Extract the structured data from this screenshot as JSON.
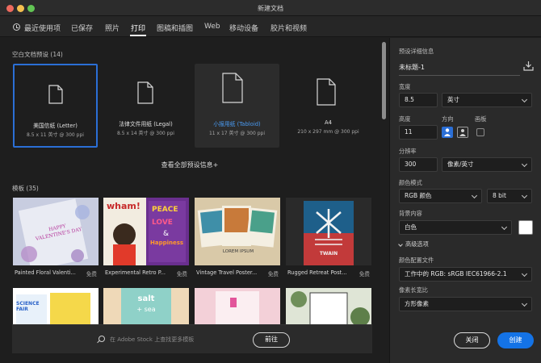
{
  "window": {
    "title": "新建文档"
  },
  "tabs": [
    {
      "label": "最近使用项"
    },
    {
      "label": "已保存"
    },
    {
      "label": "照片"
    },
    {
      "label": "打印"
    },
    {
      "label": "图稿和插图"
    },
    {
      "label": "Web"
    },
    {
      "label": "移动设备"
    },
    {
      "label": "胶片和视频"
    }
  ],
  "active_tab": "打印",
  "presets": {
    "label": "空白文档预设",
    "count": "(14)",
    "items": [
      {
        "name": "美国信纸 (Letter)",
        "detail": "8.5 x 11 英寸 @ 300 ppi",
        "state": "selected"
      },
      {
        "name": "法律文件用纸 (Legal)",
        "detail": "8.5 x 14 英寸 @ 300 ppi",
        "state": "normal"
      },
      {
        "name": "小报用纸 (Tabloid)",
        "detail": "11 x 17 英寸 @ 300 ppi",
        "state": "hover"
      },
      {
        "name": "A4",
        "detail": "210 x 297 mm @ 300 ppi",
        "state": "normal"
      }
    ],
    "view_all": "查看全部预设信息+"
  },
  "templates": {
    "label": "模板",
    "count": "(35)",
    "items": [
      {
        "name": "Painted Floral Valenti...",
        "badge": "免费"
      },
      {
        "name": "Experimental Retro P...",
        "badge": "免费"
      },
      {
        "name": "Vintage Travel Poster...",
        "badge": "免费"
      },
      {
        "name": "Rugged Retreat Post...",
        "badge": "免费"
      }
    ],
    "thumb_text": {
      "valentine": "HAPPY VALENTINE'S DAY",
      "wham": "wham!",
      "peace": "PEACE",
      "love": "LOVE",
      "and": "&",
      "happiness": "Happiness",
      "lorem": "LOREM IPSUM",
      "twain": "TWAIN",
      "science": "SCIENCE FAIR",
      "salt": "salt",
      "sea": "+ sea"
    }
  },
  "search": {
    "placeholder": "在 Adobe Stock 上查找更多模板",
    "go_label": "前往"
  },
  "details": {
    "header": "预设详细信息",
    "doc_title": "未标题-1",
    "width_label": "宽度",
    "width_value": "8.5",
    "width_unit": "英寸",
    "height_label": "高度",
    "height_value": "11",
    "orientation_label": "方向",
    "artboard_label": "画板",
    "resolution_label": "分辨率",
    "resolution_value": "300",
    "resolution_unit": "像素/英寸",
    "color_mode_label": "颜色模式",
    "color_mode_value": "RGB 颜色",
    "bit_depth": "8 bit",
    "background_label": "背景内容",
    "background_value": "白色",
    "background_swatch": "#ffffff",
    "advanced_label": "高级选项",
    "profile_label": "颜色配置文件",
    "profile_value": "工作中的 RGB: sRGB IEC61966-2.1",
    "pixel_aspect_label": "像素长宽比",
    "pixel_aspect_value": "方形像素"
  },
  "actions": {
    "close": "关闭",
    "create": "创建"
  },
  "colors": {
    "accent": "#1473e6",
    "selected_border": "#2b6fd6",
    "hover_text": "#4a9cf5"
  }
}
